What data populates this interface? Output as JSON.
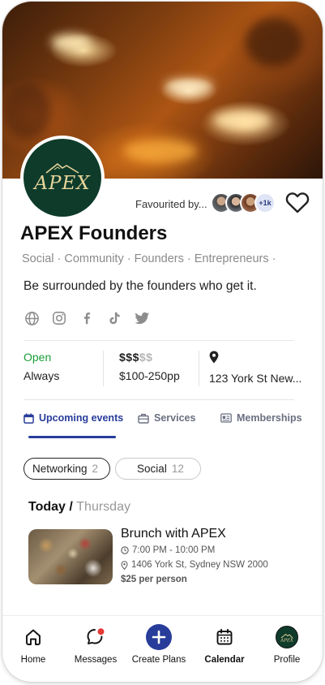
{
  "profile": {
    "logo_text": "APEX",
    "favourited_label": "Favourited by...",
    "favourited_count": "+1k",
    "name": "APEX Founders",
    "tags": "Social · Community · Founders · Entrepreneurs ·",
    "tagline": "Be surrounded by the founders who get it."
  },
  "socials": [
    "globe-icon",
    "instagram-icon",
    "facebook-icon",
    "tiktok-icon",
    "twitter-icon"
  ],
  "info": {
    "status": "Open",
    "hours": "Always",
    "price_active": "$$$",
    "price_inactive": "$$",
    "price_range": "$100-250pp",
    "address": "123 York St New..."
  },
  "tabs": [
    {
      "label": "Upcoming events",
      "icon": "calendar-icon"
    },
    {
      "label": "Services",
      "icon": "briefcase-icon"
    },
    {
      "label": "Memberships",
      "icon": "id-card-icon"
    }
  ],
  "filters": [
    {
      "label": "Networking",
      "count": "2"
    },
    {
      "label": "Social",
      "count": "12"
    }
  ],
  "day": {
    "today": "Today /",
    "weekday": "Thursday"
  },
  "event": {
    "title": "Brunch with APEX",
    "time": "7:00 PM - 10:00 PM",
    "location": "1406 York St, Sydney NSW 2000",
    "price": "$25 per person"
  },
  "nav": {
    "home": "Home",
    "messages": "Messages",
    "create": "Create Plans",
    "calendar": "Calendar",
    "profile": "Profile"
  },
  "colors": {
    "accent": "#283c9a",
    "open_green": "#1a9e3a",
    "logo_bg": "#0f3b2b",
    "logo_gold": "#e6d49a",
    "notification_red": "#e53935"
  }
}
